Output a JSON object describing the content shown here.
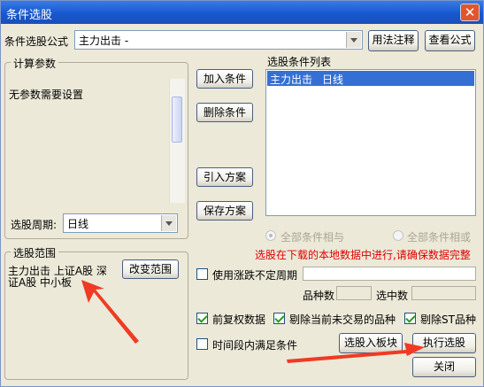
{
  "dialog": {
    "title": "条件选股",
    "close_glyph": "✕"
  },
  "formula": {
    "label": "条件选股公式",
    "value": "主力出击        -",
    "usage_btn": "用法注释",
    "view_btn": "查看公式"
  },
  "params": {
    "legend": "计算参数",
    "text": "无参数需要设置",
    "period_label": "选股周期:",
    "period_value": "日线"
  },
  "actions": {
    "add": "加入条件",
    "delete": "删除条件",
    "import": "引入方案",
    "save": "保存方案"
  },
  "conditions": {
    "legend": "选股条件列表",
    "items": [
      {
        "name": "主力出击",
        "period": "日线"
      }
    ]
  },
  "logic": {
    "all_and": "全部条件相与",
    "all_or": "全部条件相或"
  },
  "notice": "选股在下载的本地数据中进行,请确保数据完整",
  "range": {
    "legend": "选股范围",
    "text_line1": "主力出击 上证A股 深",
    "text_line2": "证A股 中小板",
    "change_btn": "改变范围"
  },
  "options": {
    "irregular_period": "使用涨跌不定周期",
    "count_label": "品种数",
    "selected_label": "选中数",
    "pre_adjust": "前复权数据",
    "exclude_untraded": "剔除当前未交易的品种",
    "exclude_st": "剔除ST品种",
    "time_range": "时间段内满足条件"
  },
  "bottom": {
    "to_block": "选股入板块",
    "execute": "执行选股",
    "close": "关闭"
  },
  "colors": {
    "notice": "#e00000",
    "arrow": "#f03a24",
    "title_bar": "#1b5ad6",
    "selection": "#3470d4"
  }
}
